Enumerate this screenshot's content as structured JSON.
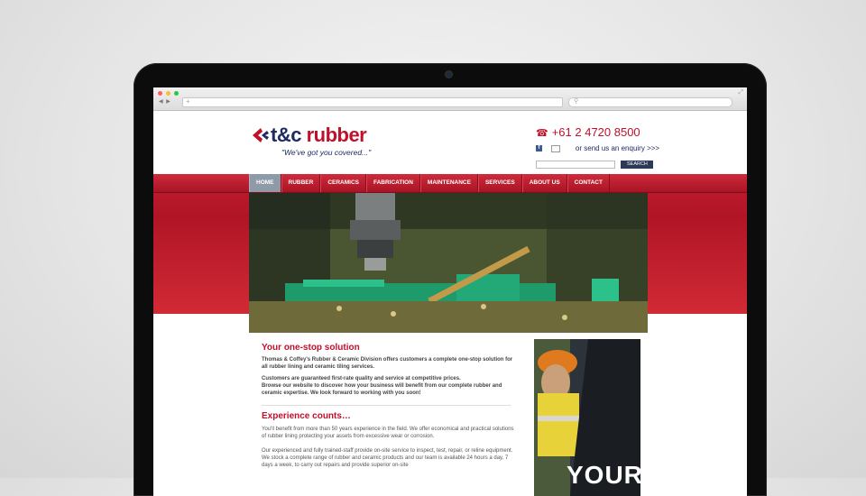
{
  "browser": {
    "url_placeholder": "+",
    "search_placeholder": "🔍"
  },
  "header": {
    "logo_prefix": "t&c",
    "logo_suffix": " rubber",
    "tagline": "\"We've got you covered...\"",
    "phone": "+61 2 4720 8500",
    "enquiry_link": "or send us an enquiry >>>",
    "search_button": "SEARCH"
  },
  "nav": {
    "items": [
      "HOME",
      "RUBBER",
      "CERAMICS",
      "FABRICATION",
      "MAINTENANCE",
      "SERVICES",
      "ABOUT US",
      "CONTACT"
    ],
    "active": "HOME"
  },
  "content": {
    "heading1": "Your one-stop solution",
    "intro": "Thomas & Coffey's Rubber & Ceramic Division offers customers a complete one-stop solution for all rubber lining and ceramic tiling services.",
    "guarantee": "Customers are guaranteed first-rate quality and service at competitive prices.",
    "browse": "Browse our website to discover how your business will benefit from our complete rubber and ceramic expertise. We look forward to working with you soon!",
    "heading2": "Experience counts…",
    "exp1": "You'll benefit from more than 50 years experience in the field. We offer economical and practical solutions of rubber lining protecting your assets from excessive wear or corrosion.",
    "exp2": "Our experienced and fully trained-staff provide on-site service to inspect, test, repair, or reline equipment. We stock a complete range of rubber and ceramic products and our team is available 24 hours a day, 7 days a week, to carry out repairs and provide superior on-site",
    "side_banner": "YOUR"
  },
  "colors": {
    "brand_red": "#c0102a",
    "brand_navy": "#1d2c63",
    "nav_active": "#8f9aa8"
  },
  "icons": {
    "phone": "phone-icon",
    "facebook": "facebook-icon",
    "mail": "mail-icon",
    "logo": "logo-mark-icon"
  }
}
